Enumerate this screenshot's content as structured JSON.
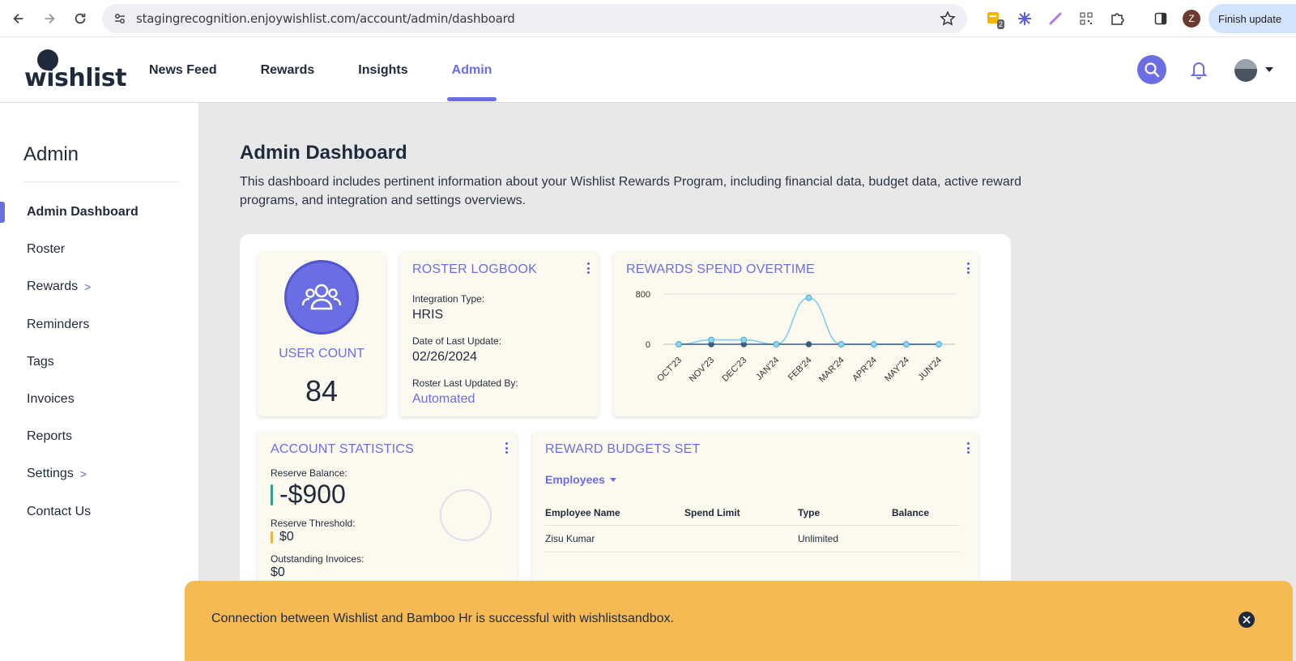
{
  "browser": {
    "url": "stagingrecognition.enjoywishlist.com/account/admin/dashboard",
    "extension_badge": "2",
    "profile_initial": "Z",
    "finish_update_label": "Finish update"
  },
  "header": {
    "logo_text": "wishlist",
    "nav": [
      {
        "label": "News Feed",
        "active": false
      },
      {
        "label": "Rewards",
        "active": false
      },
      {
        "label": "Insights",
        "active": false
      },
      {
        "label": "Admin",
        "active": true
      }
    ],
    "accent_color": "#6b6ee3"
  },
  "sidebar": {
    "title": "Admin",
    "items": [
      {
        "label": "Admin Dashboard",
        "active": true,
        "chevron": ""
      },
      {
        "label": "Roster",
        "active": false,
        "chevron": ""
      },
      {
        "label": "Rewards",
        "active": false,
        "chevron": ">"
      },
      {
        "label": "Reminders",
        "active": false,
        "chevron": ""
      },
      {
        "label": "Tags",
        "active": false,
        "chevron": ""
      },
      {
        "label": "Invoices",
        "active": false,
        "chevron": ""
      },
      {
        "label": "Reports",
        "active": false,
        "chevron": ""
      },
      {
        "label": "Settings",
        "active": false,
        "chevron": ">"
      },
      {
        "label": "Contact Us",
        "active": false,
        "chevron": ""
      }
    ]
  },
  "main": {
    "title": "Admin Dashboard",
    "description": "This dashboard includes pertinent information about your Wishlist Rewards Program, including financial data, budget data, active reward programs, and integration and settings overviews."
  },
  "user_count": {
    "label": "USER COUNT",
    "value": "84"
  },
  "roster_logbook": {
    "title": "ROSTER LOGBOOK",
    "integration_label": "Integration Type:",
    "integration_value": "HRIS",
    "date_label": "Date of Last Update:",
    "date_value": "02/26/2024",
    "updated_by_label": "Roster Last Updated By:",
    "updated_by_value": "Automated"
  },
  "rewards_spend": {
    "title": "REWARDS SPEND OVERTIME"
  },
  "chart_data": {
    "type": "line",
    "title": "REWARDS SPEND OVERTIME",
    "categories": [
      "OCT'23",
      "NOV'23",
      "DEC'23",
      "JAN'24",
      "FEB'24",
      "MAR'24",
      "APR'24",
      "MAY'24",
      "JUN'24"
    ],
    "series": [
      {
        "values": [
          0,
          70,
          70,
          0,
          740,
          0,
          0,
          0,
          0
        ],
        "color": "#7fd0ee"
      },
      {
        "values": [
          0,
          0,
          0,
          0,
          0,
          0,
          0,
          0,
          0
        ],
        "color": "#3c5a7a"
      }
    ],
    "y_ticks": [
      "800",
      "0"
    ],
    "ylim": [
      0,
      800
    ],
    "grid": true
  },
  "account_statistics": {
    "title": "ACCOUNT STATISTICS",
    "reserve_balance_label": "Reserve Balance:",
    "reserve_balance_value": "-$900",
    "reserve_threshold_label": "Reserve Threshold:",
    "reserve_threshold_value": "$0",
    "outstanding_label": "Outstanding Invoices:",
    "outstanding_value": "$0",
    "balance_color": "#2e9e8f",
    "threshold_color": "#f0b342"
  },
  "reward_budgets": {
    "title": "REWARD BUDGETS SET",
    "filter": "Employees",
    "columns": [
      "Employee Name",
      "Spend Limit",
      "Type",
      "Balance"
    ],
    "rows": [
      [
        "Zisu Kumar",
        "",
        "Unlimited",
        ""
      ]
    ]
  },
  "toast": {
    "message": "Connection between Wishlist and Bamboo Hr is successful with wishlistsandbox.",
    "color": "#f6ba55"
  }
}
